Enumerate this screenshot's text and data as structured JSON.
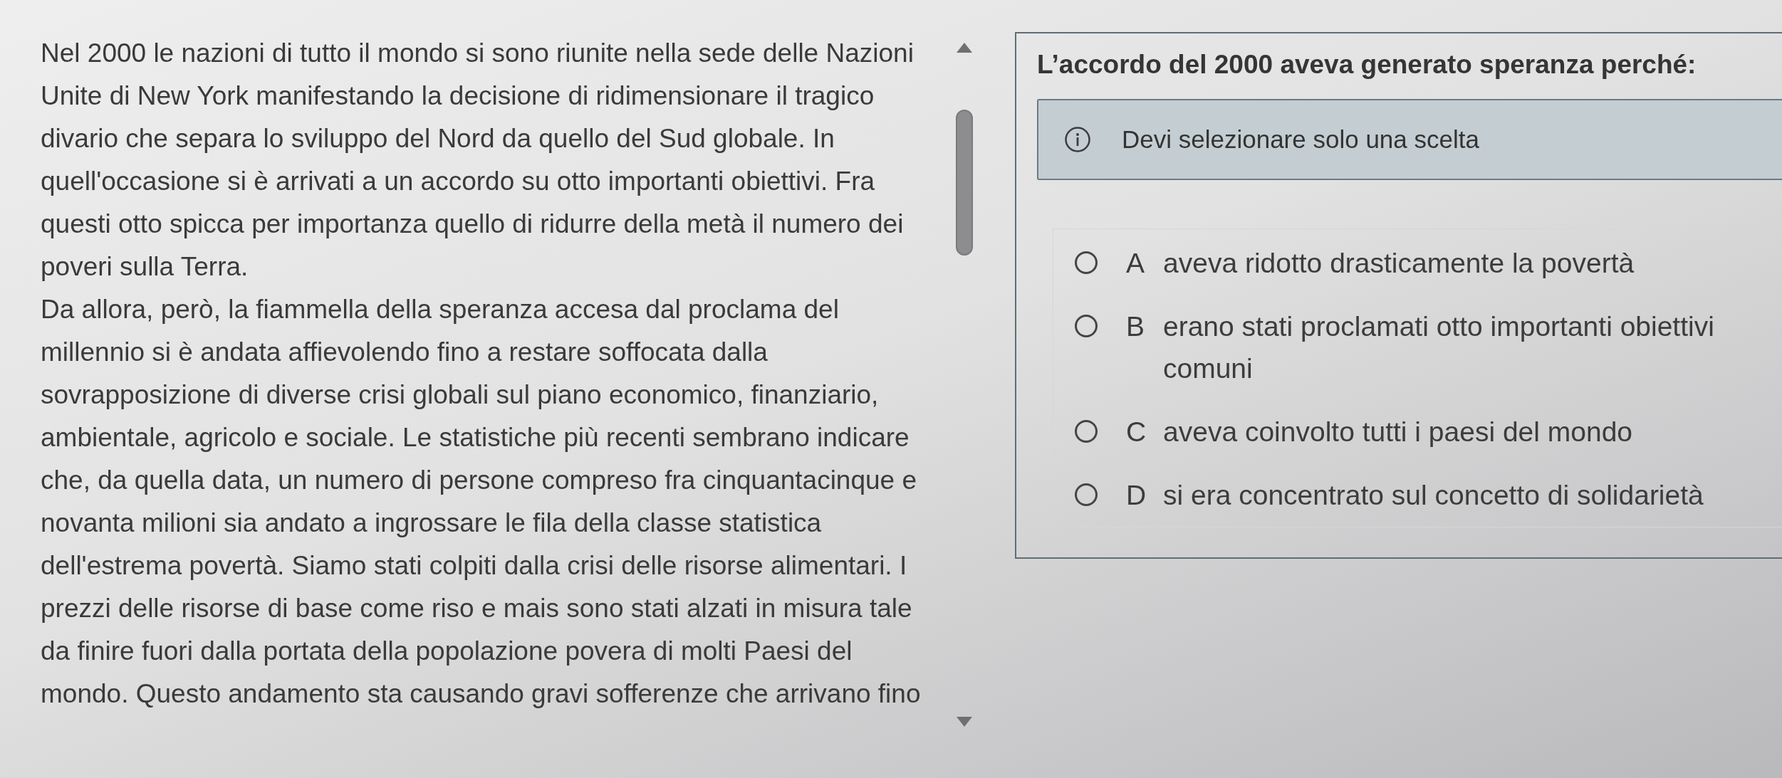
{
  "passage": {
    "paragraphs": [
      "Nel 2000 le nazioni di tutto il mondo si sono riunite nella sede delle Nazioni Unite di New York manifestando la decisione di ridimensionare il tragico divario che separa lo sviluppo del Nord da quello del Sud globale. In quell'occasione si è arrivati a un accordo su otto importanti obiettivi. Fra questi otto spicca per importanza quello di ridurre della metà il numero dei poveri sulla Terra.",
      "Da allora, però, la fiammella della speranza accesa dal proclama del millennio si è andata affievolendo fino a restare soffocata dalla sovrapposizione di diverse crisi globali sul piano economico, finanziario, ambientale, agricolo e sociale. Le statistiche più recenti sembrano indicare che, da quella data, un numero di persone compreso fra cinquantacinque e novanta milioni sia andato a ingrossare le fila della classe statistica dell'estrema povertà. Siamo stati colpiti dalla crisi delle risorse alimentari. I prezzi delle risorse di base come riso e mais sono stati alzati in misura tale da finire fuori dalla portata della popolazione povera di molti Paesi del mondo. Questo andamento sta causando gravi sofferenze che arrivano fino"
    ]
  },
  "question": {
    "title": "L’accordo del 2000 aveva generato speranza perché:",
    "notice": "Devi selezionare solo una scelta",
    "options": [
      {
        "letter": "A",
        "text": "aveva ridotto drasticamente la povertà",
        "selected": false
      },
      {
        "letter": "B",
        "text": "erano stati proclamati otto importanti obiettivi comuni",
        "selected": false
      },
      {
        "letter": "C",
        "text": "aveva coinvolto tutti i paesi del mondo",
        "selected": false
      },
      {
        "letter": "D",
        "text": "si era concentrato sul concetto di solidarietà",
        "selected": false
      }
    ]
  }
}
